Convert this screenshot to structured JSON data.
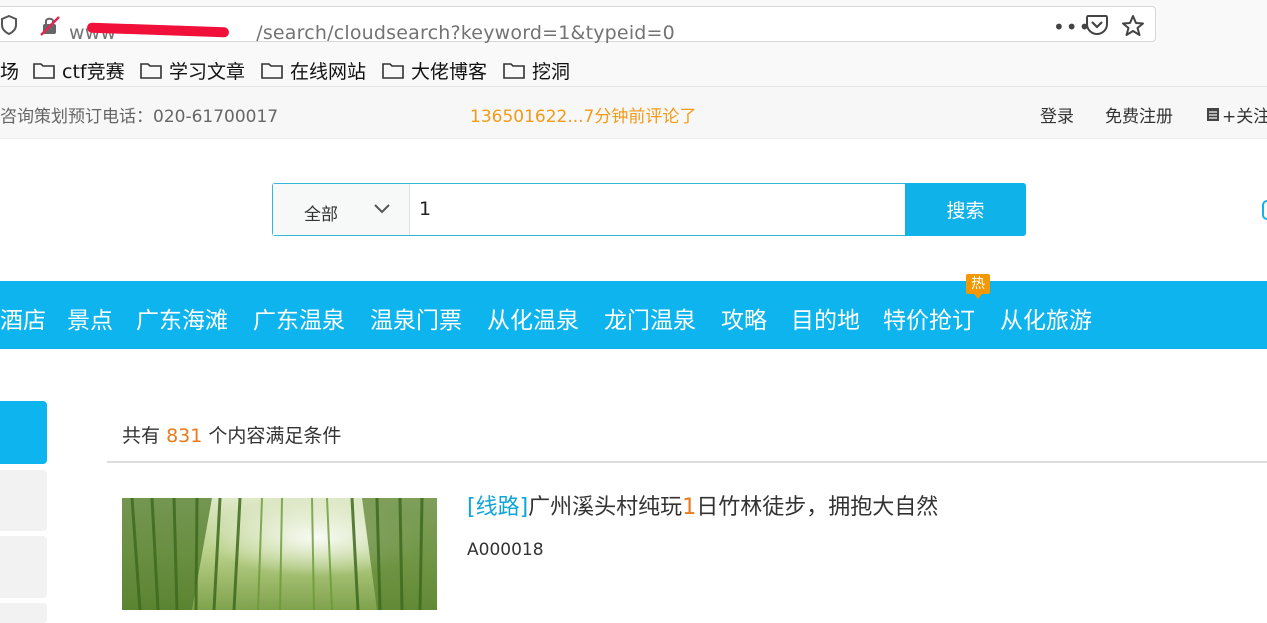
{
  "browser": {
    "url_prefix": "www",
    "url_suffix": "/search/cloudsearch?keyword=1&typeid=0",
    "bookmarks": [
      "场",
      "ctf竞赛",
      "学习文章",
      "在线网站",
      "大佬博客",
      "挖洞"
    ]
  },
  "topbar": {
    "phone": "咨询策划预订电话：020-61700017",
    "notice": "136501622...7分钟前评论了",
    "login": "登录",
    "register": "免费注册",
    "follow": "+关注"
  },
  "search": {
    "type_label": "全部",
    "query": "1",
    "button_label": "搜索"
  },
  "nav": {
    "items": [
      "酒店",
      "景点",
      "广东海滩",
      "广东温泉",
      "温泉门票",
      "从化温泉",
      "龙门温泉",
      "攻略",
      "目的地",
      "特价抢订",
      "从化旅游"
    ],
    "hot_badge": "热"
  },
  "results": {
    "count_prefix": "共有",
    "count": "831",
    "count_suffix": "个内容满足条件",
    "items": [
      {
        "tag": "[线路]",
        "title_before": "广州溪头村纯玩",
        "title_highlight": "1",
        "title_after": "日竹林徒步，拥抱大自然",
        "code": "A000018"
      }
    ]
  },
  "colors": {
    "accent": "#0db4ed",
    "highlight": "#ea7a1c",
    "notice": "#f29b17"
  }
}
